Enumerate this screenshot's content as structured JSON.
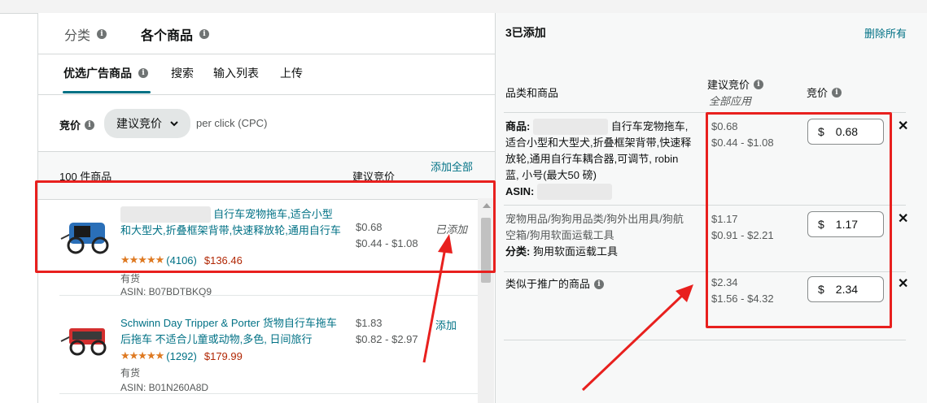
{
  "left": {
    "tabs": [
      {
        "label": "分类"
      },
      {
        "label": "各个商品"
      }
    ],
    "subtabs": [
      {
        "label": "优选广告商品"
      },
      {
        "label": "搜索"
      },
      {
        "label": "输入列表"
      },
      {
        "label": "上传"
      }
    ],
    "bid": {
      "label": "竞价",
      "select_value": "建议竞价",
      "per_click": "per click (CPC)"
    },
    "list": {
      "count": "100 件商品",
      "col_bid": "建议竞价",
      "add_all": "添加全部",
      "items": [
        {
          "title_visible": "自行车宠物拖车,适合小型和大型犬,折叠框架背带,快速释放轮,通用自行车",
          "stars": "★★★★★",
          "reviews": "(4106)",
          "price": "$136.46",
          "stock": "有货",
          "asin": "ASIN: B07BDTBKQ9",
          "bid": "$0.68",
          "bid_range": "$0.44 - $1.08",
          "action": "已添加"
        },
        {
          "title_visible": "Schwinn Day Tripper & Porter 货物自行车拖车 后拖车 不适合儿童或动物,多色, 日间旅行",
          "stars": "★★★★★",
          "reviews": "(1292)",
          "price": "$179.99",
          "stock": "有货",
          "asin": "ASIN: B01N260A8D",
          "bid": "$1.83",
          "bid_range": "$0.82 - $2.97",
          "action": "添加"
        }
      ]
    }
  },
  "right": {
    "title": "3已添加",
    "delete_all": "删除所有",
    "headers": {
      "product": "品类和商品",
      "suggested": "建议竞价",
      "apply_all": "全部应用",
      "bid": "竞价"
    },
    "rows": [
      {
        "label": "商品:",
        "text": "自行车宠物拖车,适合小型和大型犬,折叠框架背带,快速释放轮,通用自行车耦合器,可调节, robin 蓝, 小号(最大50 磅)",
        "asin": "ASIN:",
        "bid": "$0.68",
        "bid_range": "$0.44 - $1.08",
        "currency": "$",
        "value": "0.68"
      },
      {
        "text": "宠物用品/狗狗用品类/狗外出用具/狗航空箱/狗用软面运载工具",
        "label": "分类:",
        "sub": "狗用软面运载工具",
        "bid": "$1.17",
        "bid_range": "$0.91 - $2.21",
        "currency": "$",
        "value": "1.17"
      },
      {
        "text": "类似于推广的商品",
        "bid": "$2.34",
        "bid_range": "$1.56 - $4.32",
        "currency": "$",
        "value": "2.34"
      }
    ]
  },
  "icons": {
    "info": "info-icon",
    "close": "close-icon",
    "chevron": "chevron-down-icon"
  },
  "colors": {
    "link": "#007185",
    "annotation": "#e8201e",
    "price": "#b12704",
    "star": "#de7921"
  }
}
